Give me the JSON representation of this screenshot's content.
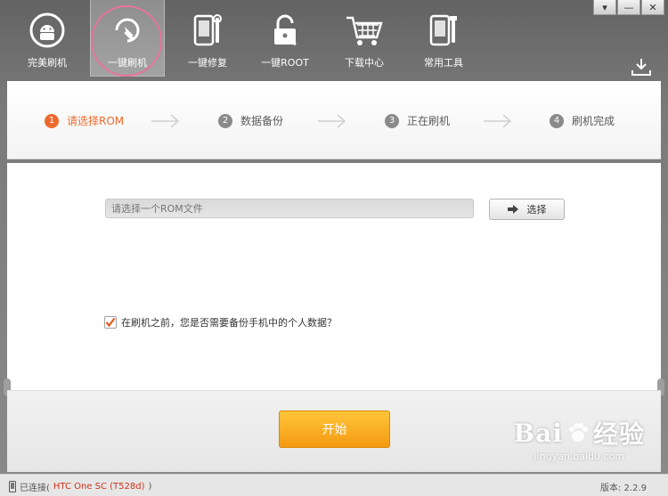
{
  "window": {
    "controls": [
      "▾",
      "—",
      "✕"
    ]
  },
  "toolbar": {
    "items": [
      {
        "label": "完美刷机",
        "icon": "android-icon"
      },
      {
        "label": "一键刷机",
        "icon": "flash-arrow-icon"
      },
      {
        "label": "一键修复",
        "icon": "phone-wrench-icon"
      },
      {
        "label": "一键ROOT",
        "icon": "lock-icon"
      },
      {
        "label": "下载中心",
        "icon": "cart-icon"
      },
      {
        "label": "常用工具",
        "icon": "tools-icon"
      }
    ],
    "active_index": 1
  },
  "steps": [
    {
      "num": "1",
      "label": "请选择ROM"
    },
    {
      "num": "2",
      "label": "数据备份"
    },
    {
      "num": "3",
      "label": "正在刷机"
    },
    {
      "num": "4",
      "label": "刷机完成"
    }
  ],
  "rom": {
    "placeholder": "请选择一个ROM文件",
    "choose_label": "选择"
  },
  "backup": {
    "checked": true,
    "label": "在刷机之前，您是否需要备份手机中的个人数据？"
  },
  "start_label": "开始",
  "status": {
    "connected_prefix": "已连接(",
    "device": "HTC One SC (T528d)",
    "connected_suffix": ")",
    "version": "版本: 2.2.9"
  },
  "watermark": {
    "brand": "Bai",
    "brand2": "经验",
    "sub": "jingyan.baidu.com"
  },
  "colors": {
    "accent": "#ee6a2c",
    "start": "#f7a51e",
    "highlight_ring": "#e8739a",
    "device_text": "#d0301a"
  }
}
